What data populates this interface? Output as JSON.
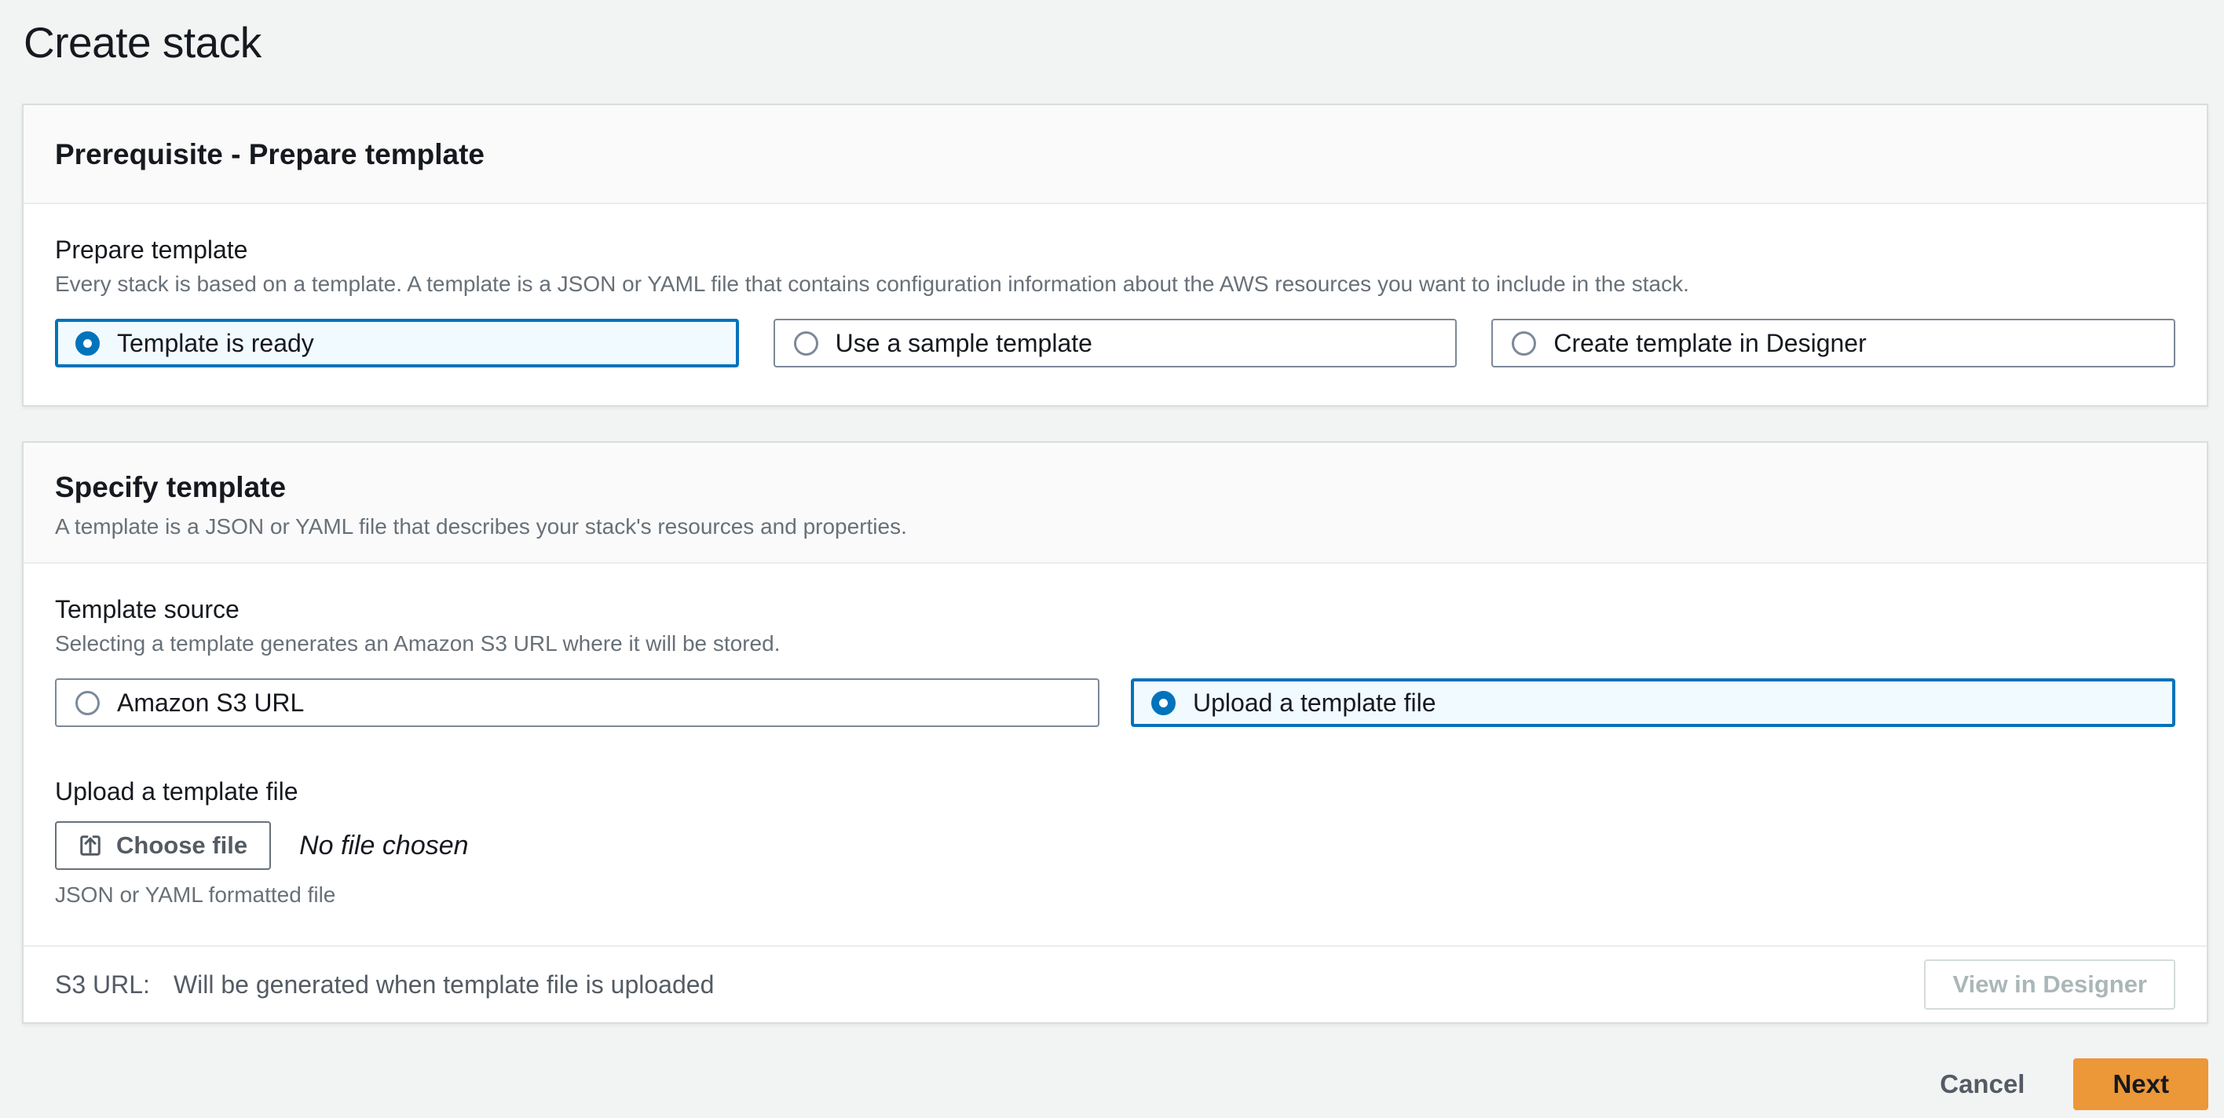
{
  "page": {
    "title": "Create stack"
  },
  "colors": {
    "page_bg": "#f2f3f3",
    "accent_blue": "#0073bb",
    "selected_tile_bg": "#f1faff",
    "primary_button_bg": "#ec9738",
    "card_header_bg": "#fafafa",
    "secondary_text": "#687078"
  },
  "prerequisite_card": {
    "title": "Prerequisite - Prepare template",
    "prepare_template": {
      "label": "Prepare template",
      "description": "Every stack is based on a template. A template is a JSON or YAML file that contains configuration information about the AWS resources you want to include in the stack.",
      "options": [
        {
          "label": "Template is ready",
          "selected": true
        },
        {
          "label": "Use a sample template",
          "selected": false
        },
        {
          "label": "Create template in Designer",
          "selected": false
        }
      ]
    }
  },
  "specify_card": {
    "title": "Specify template",
    "description": "A template is a JSON or YAML file that describes your stack's resources and properties.",
    "template_source": {
      "label": "Template source",
      "description": "Selecting a template generates an Amazon S3 URL where it will be stored.",
      "options": [
        {
          "label": "Amazon S3 URL",
          "selected": false
        },
        {
          "label": "Upload a template file",
          "selected": true
        }
      ]
    },
    "upload": {
      "label": "Upload a template file",
      "choose_file_button": "Choose file",
      "file_status": "No file chosen",
      "hint": "JSON or YAML formatted file",
      "icon": "upload-icon"
    },
    "s3_url": {
      "label": "S3 URL:",
      "value": "Will be generated when template file is uploaded",
      "view_in_designer_button": "View in Designer"
    }
  },
  "footer": {
    "cancel_button": "Cancel",
    "next_button": "Next"
  }
}
